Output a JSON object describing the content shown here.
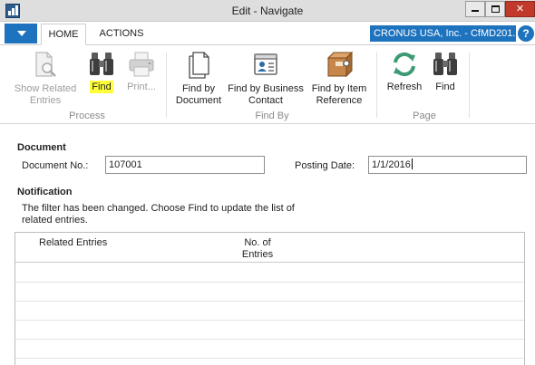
{
  "window": {
    "title": "Edit - Navigate",
    "icon": "dynamics-nav-app-icon"
  },
  "tabs": [
    {
      "label": "HOME",
      "active": true
    },
    {
      "label": "ACTIONS",
      "active": false
    }
  ],
  "company": {
    "name": "CRONUS USA, Inc. - CfMD201..."
  },
  "help": {
    "glyph": "?"
  },
  "ribbon": {
    "groups": {
      "process": "Process",
      "find_by": "Find By",
      "page": "Page"
    },
    "buttons": {
      "show_related": {
        "label": "Show Related Entries",
        "icon": "show-related-entries-icon",
        "enabled": false
      },
      "find_process": {
        "label": "Find",
        "icon": "binoculars-icon",
        "enabled": true,
        "highlighted": true,
        "highlight_color": "#ffff3a"
      },
      "print": {
        "label": "Print...",
        "icon": "printer-icon",
        "enabled": false
      },
      "find_by_document": {
        "label": "Find by Document",
        "icon": "document-icon",
        "enabled": true
      },
      "find_by_business_contact": {
        "label": "Find by Business Contact",
        "icon": "contact-card-icon",
        "enabled": true
      },
      "find_by_item_reference": {
        "label": "Find by Item Reference",
        "icon": "item-box-icon",
        "enabled": true
      },
      "refresh": {
        "label": "Refresh",
        "icon": "refresh-icon",
        "enabled": true
      },
      "find_page": {
        "label": "Find",
        "icon": "binoculars-icon",
        "enabled": true
      }
    }
  },
  "document": {
    "heading": "Document",
    "document_no_label": "Document No.:",
    "document_no_value": "107001",
    "posting_date_label": "Posting Date:",
    "posting_date_value": "1/1/2016"
  },
  "notification": {
    "heading": "Notification",
    "message": "The filter has been changed. Choose Find to update the list of related entries."
  },
  "grid": {
    "columns": [
      "Related Entries",
      "No. of Entries"
    ],
    "rows": []
  },
  "colors": {
    "accent": "#1e73be",
    "close": "#c0392b",
    "highlight": "#ffff3a"
  }
}
